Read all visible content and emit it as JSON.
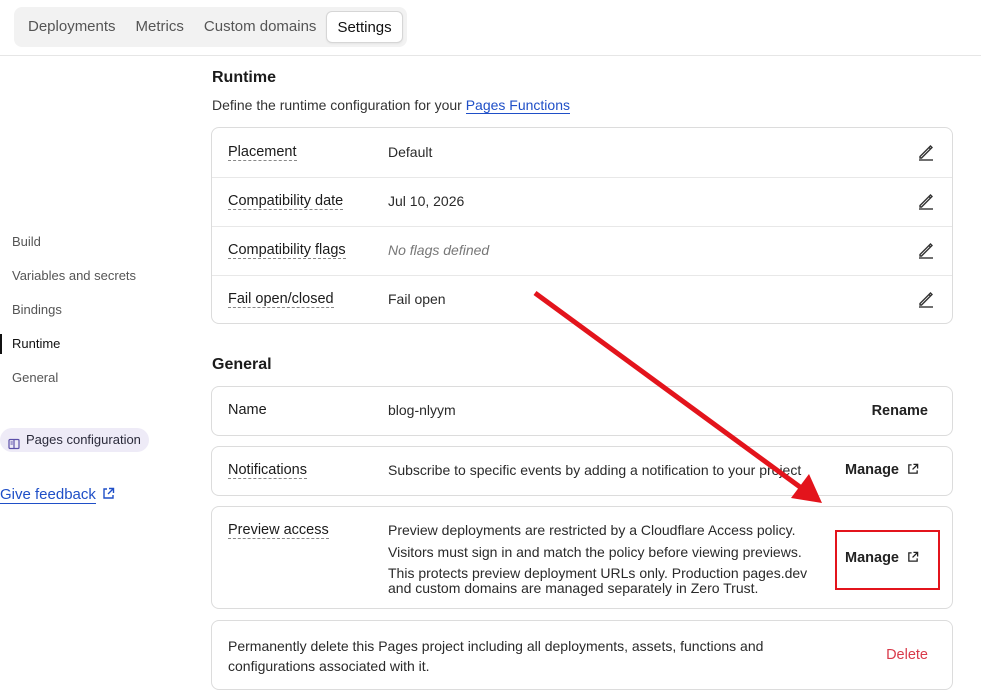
{
  "tabs": [
    "Deployments",
    "Metrics",
    "Custom domains",
    "Settings"
  ],
  "active_tab": "Settings",
  "sidebar": {
    "items": [
      "Build",
      "Variables and secrets",
      "Bindings",
      "Runtime",
      "General"
    ],
    "active": "Runtime",
    "pages_config": "Pages configuration",
    "feedback": "Give feedback"
  },
  "runtime": {
    "title": "Runtime",
    "subtitle_prefix": "Define the runtime configuration for your ",
    "subtitle_link": "Pages Functions",
    "rows": [
      {
        "label": "Placement",
        "value": "Default"
      },
      {
        "label": "Compatibility date",
        "value": "Jul 10, 2026"
      },
      {
        "label": "Compatibility flags",
        "value": "No flags defined"
      },
      {
        "label": "Fail open/closed",
        "value": "Fail open"
      }
    ]
  },
  "general": {
    "title": "General",
    "name_label": "Name",
    "name_value": "blog-nlyym",
    "rename": "Rename",
    "notifications_label": "Notifications",
    "notifications_value": "Subscribe to specific events by adding a notification to your project",
    "manage": "Manage",
    "preview_label": "Preview access",
    "preview_value": "Preview deployments are restricted by a Cloudflare Access policy.",
    "preview_note1": "Visitors must sign in and match the policy before viewing previews.",
    "preview_note2": "This protects preview deployment URLs only. Production pages.dev and custom domains are managed separately in Zero Trust.",
    "delete_text": "Permanently delete this Pages project including all deployments, assets, functions and configurations associated with it.",
    "delete": "Delete"
  },
  "colors": {
    "accent": "#1f4fc7",
    "danger": "#d93a4a",
    "annotation": "#e3141c"
  }
}
